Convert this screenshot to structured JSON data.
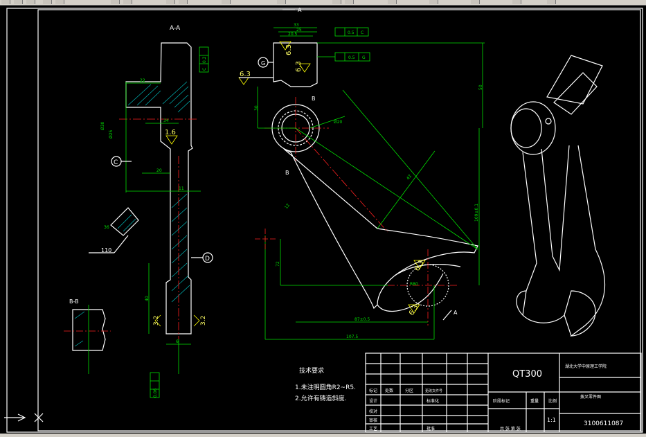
{
  "section_labels": {
    "aa": "A-A",
    "bb": "B-B",
    "a_top": "A",
    "a_bottom": "A",
    "b_upper": "B",
    "b_lower": "B"
  },
  "datum_labels": {
    "c": "C",
    "d": "D",
    "g": "G"
  },
  "roughness": {
    "r1": "6.3",
    "r2": "6.3",
    "r3": "6.3",
    "r4": "6.3",
    "r5": "6.3",
    "r6": "1.6",
    "r7": "3.2",
    "r8": "3.2",
    "r9": "6.3"
  },
  "dimensions": {
    "d33": "33",
    "d25": "25",
    "d20_5": "20.5",
    "d50": "50",
    "d30": "30",
    "d20": "Ø20",
    "d22": "22",
    "d30_aa": "Ø30",
    "d25_aa": "Ø25",
    "d20_aa": "20",
    "d34": "34",
    "d11": "11",
    "d40": "40",
    "d6": "6",
    "d110": "110",
    "d36": "36",
    "d1_4": "1:1",
    "d72": "72",
    "d87": "87±0.5",
    "d107_5": "107.5",
    "d109": "109±0.1",
    "d42": "42",
    "d12": "12",
    "d80": "R80"
  },
  "tolerances": {
    "t1_val": "0.5",
    "t1_ref": "C",
    "t2_val": "0.5",
    "t2_ref": "G",
    "t3_val": "0.2",
    "t3_ref": "C",
    "t4_val": "0.06"
  },
  "tech_requirements": {
    "heading": "技术要求",
    "line1": "1.未注明圆角R2~R5.",
    "line2": "2.允许有铸造斜度."
  },
  "title_block": {
    "material": "QT300",
    "school": "湖北大学中原理工学院",
    "part_name": "拨叉零件图",
    "scale_label": "比例",
    "scale_value": "1:1",
    "drawing_no": "3100611087",
    "weight_label": "重量",
    "stage_label": "阶段标记",
    "rows": {
      "mark": "标记",
      "count": "处数",
      "zone": "分区",
      "change_no": "更改文件号",
      "design": "设计",
      "std": "标准化",
      "review": "审核",
      "process": "工艺",
      "check": "校对",
      "approve": "批准",
      "total": "共  张  第  张"
    }
  }
}
